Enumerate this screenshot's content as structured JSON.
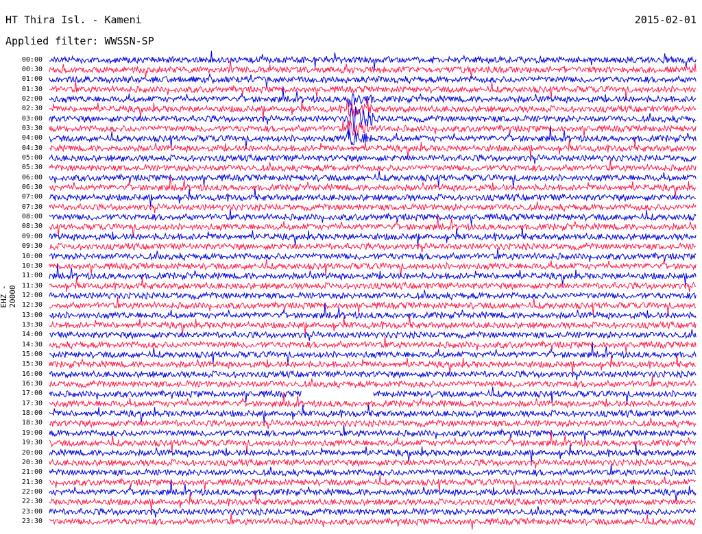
{
  "header": {
    "title": "HT Thira Isl. - Kameni",
    "date": "2015-02-01",
    "filter": "Applied filter: WWSSN-SP"
  },
  "chart_data": {
    "type": "line",
    "title": "HT Thira Isl. - Kameni",
    "subtitle": "Applied filter: WWSSN-SP",
    "ylabel": "EHZ - 20000",
    "tick_labels": [
      "00:00",
      "00:30",
      "01:00",
      "01:30",
      "02:00",
      "02:30",
      "03:00",
      "03:30",
      "04:00",
      "04:30",
      "05:00",
      "05:30",
      "06:00",
      "06:30",
      "07:00",
      "07:30",
      "08:00",
      "08:30",
      "09:00",
      "09:30",
      "10:00",
      "10:30",
      "11:00",
      "11:30",
      "12:00",
      "12:30",
      "13:00",
      "13:30",
      "14:00",
      "14:30",
      "15:00",
      "15:30",
      "16:00",
      "16:30",
      "17:00",
      "17:30",
      "18:00",
      "18:30",
      "19:00",
      "19:30",
      "20:00",
      "20:30",
      "21:00",
      "21:30",
      "22:00",
      "22:30",
      "23:00",
      "23:30"
    ],
    "series_colors": [
      "#0000dd",
      "#ff1a4a"
    ],
    "events": [
      {
        "line": "03:00",
        "x_fraction": 0.46,
        "amplitude": "large"
      },
      {
        "line": "17:00",
        "gap_from_fraction": 0.39,
        "gap_to_fraction": 0.5
      }
    ]
  }
}
